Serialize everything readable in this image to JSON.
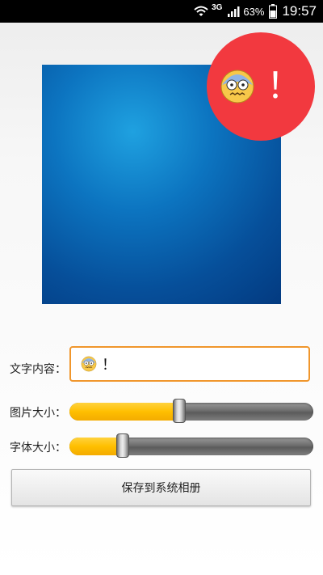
{
  "status_bar": {
    "network": "3G",
    "battery_percent": "63%",
    "time": "19:57",
    "icons": [
      "wifi-icon",
      "signal-icon",
      "battery-icon"
    ]
  },
  "preview": {
    "badge_emoji": "fearful-face-icon",
    "badge_text": "！",
    "badge_color": "#f2393f"
  },
  "form": {
    "text_content_label": "文字内容：",
    "text_content_value": "！",
    "text_content_emoji": "fearful-face-icon",
    "image_size_label": "图片大小：",
    "image_size_value": 0.45,
    "font_size_label": "字体大小：",
    "font_size_value": 0.22,
    "save_button_label": "保存到系统相册"
  },
  "colors": {
    "accent_orange": "#f0962c",
    "slider_fill": "#ffbf00"
  }
}
